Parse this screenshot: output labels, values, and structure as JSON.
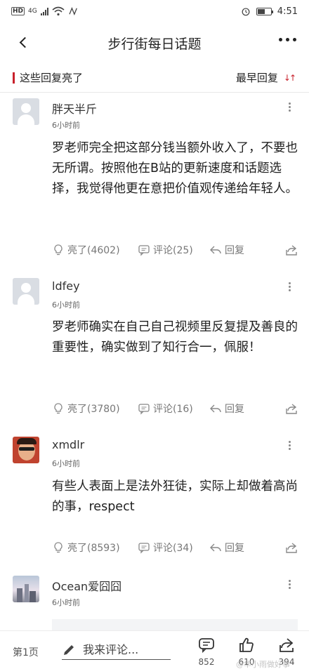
{
  "statusbar": {
    "hd": "HD",
    "network": "4G",
    "time": "4:51",
    "battery_level": 0.55
  },
  "navbar": {
    "title": "步行街每日话题"
  },
  "section": {
    "title": "这些回复亮了",
    "sort_label": "最早回复"
  },
  "comments": [
    {
      "user": "胖天半斤",
      "time": "6小时前",
      "text": "罗老师完全把这部分钱当额外收入了，不要也无所谓。按照他在B站的更新速度和话题选择，我觉得他更在意把价值观传递给年轻人。",
      "light": "亮了(4602)",
      "comments": "评论(25)",
      "reply": "回复"
    },
    {
      "user": "ldfey",
      "time": "6小时前",
      "text": "罗老师确实在自己自己视频里反复提及善良的重要性，确实做到了知行合一，佩服！",
      "light": "亮了(3780)",
      "comments": "评论(16)",
      "reply": "回复"
    },
    {
      "user": "xmdlr",
      "time": "6小时前",
      "text": "有些人表面上是法外狂徒，实际上却做着高尚的事，respect",
      "light": "亮了(8593)",
      "comments": "评论(34)",
      "reply": "回复"
    },
    {
      "user": "Ocean爱囧囧",
      "time": "6小时前"
    }
  ],
  "bottombar": {
    "page": "第1页",
    "input_placeholder": "我来评论...",
    "comment_count": "852",
    "like_count": "610",
    "share_count": "394"
  },
  "watermark": "@华小雨做好事"
}
